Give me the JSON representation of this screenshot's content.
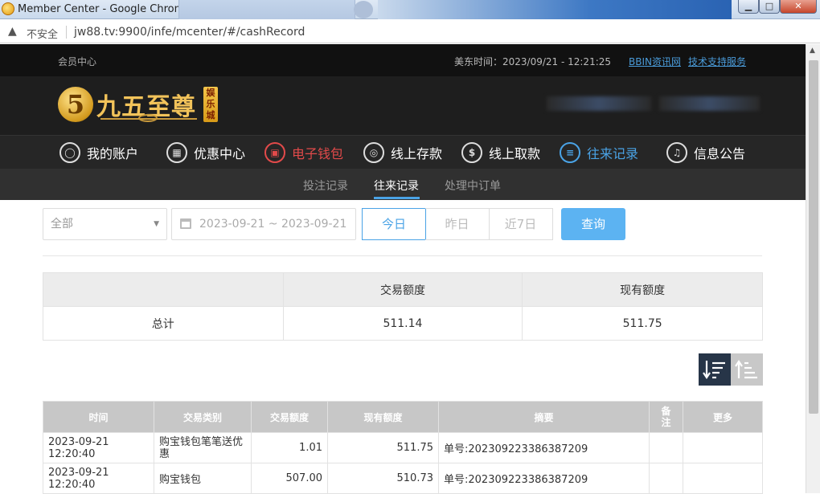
{
  "window": {
    "title": "Member Center - Google Chrome",
    "min_glyph": "▁",
    "max_glyph": "□",
    "close_glyph": "✕"
  },
  "addressbar": {
    "security_label": "不安全",
    "url": "jw88.tv:9900/infe/mcenter/#/cashRecord"
  },
  "site_top": {
    "member_center": "会员中心",
    "time": "美东时间：2023/09/21 - 12:21:25",
    "link_news": "BBIN资讯网",
    "link_support": "技术支持服务"
  },
  "logo": {
    "digit": "5",
    "text": "九五至尊",
    "badge": "娱乐城"
  },
  "nav": [
    {
      "label": "我的账户",
      "icon": "user-icon",
      "glyph": "◯"
    },
    {
      "label": "优惠中心",
      "icon": "gift-icon",
      "glyph": "▦"
    },
    {
      "label": "电子钱包",
      "icon": "wallet-icon",
      "glyph": "▣"
    },
    {
      "label": "线上存款",
      "icon": "deposit-icon",
      "glyph": "◎"
    },
    {
      "label": "线上取款",
      "icon": "withdraw-icon",
      "glyph": "$"
    },
    {
      "label": "往来记录",
      "icon": "record-icon",
      "glyph": "≡"
    },
    {
      "label": "信息公告",
      "icon": "bell-icon",
      "glyph": "♫"
    }
  ],
  "subnav": [
    "投注记录",
    "往来记录",
    "处理中订单"
  ],
  "filters": {
    "type_value": "全部",
    "date_range": "2023-09-21 ~ 2023-09-21",
    "quick": [
      "今日",
      "昨日",
      "近7日"
    ],
    "query": "查询"
  },
  "summary": {
    "headers": [
      "",
      "交易额度",
      "现有额度"
    ],
    "row": [
      "总计",
      "511.14",
      "511.75"
    ]
  },
  "records": {
    "headers": [
      "时间",
      "交易类别",
      "交易额度",
      "现有额度",
      "摘要",
      "备注",
      "更多"
    ],
    "rows": [
      [
        "2023-09-21 12:20:40",
        "购宝钱包笔笔送优惠",
        "1.01",
        "511.75",
        "单号:202309223386387209",
        "",
        ""
      ],
      [
        "2023-09-21 12:20:40",
        "购宝钱包",
        "507.00",
        "510.73",
        "单号:202309223386387209",
        "",
        ""
      ]
    ]
  },
  "colors": {
    "accent_blue": "#4aa3e6",
    "active_red": "#e24a4a",
    "query_button": "#5cb3f2",
    "gold": "#f2c35a"
  }
}
